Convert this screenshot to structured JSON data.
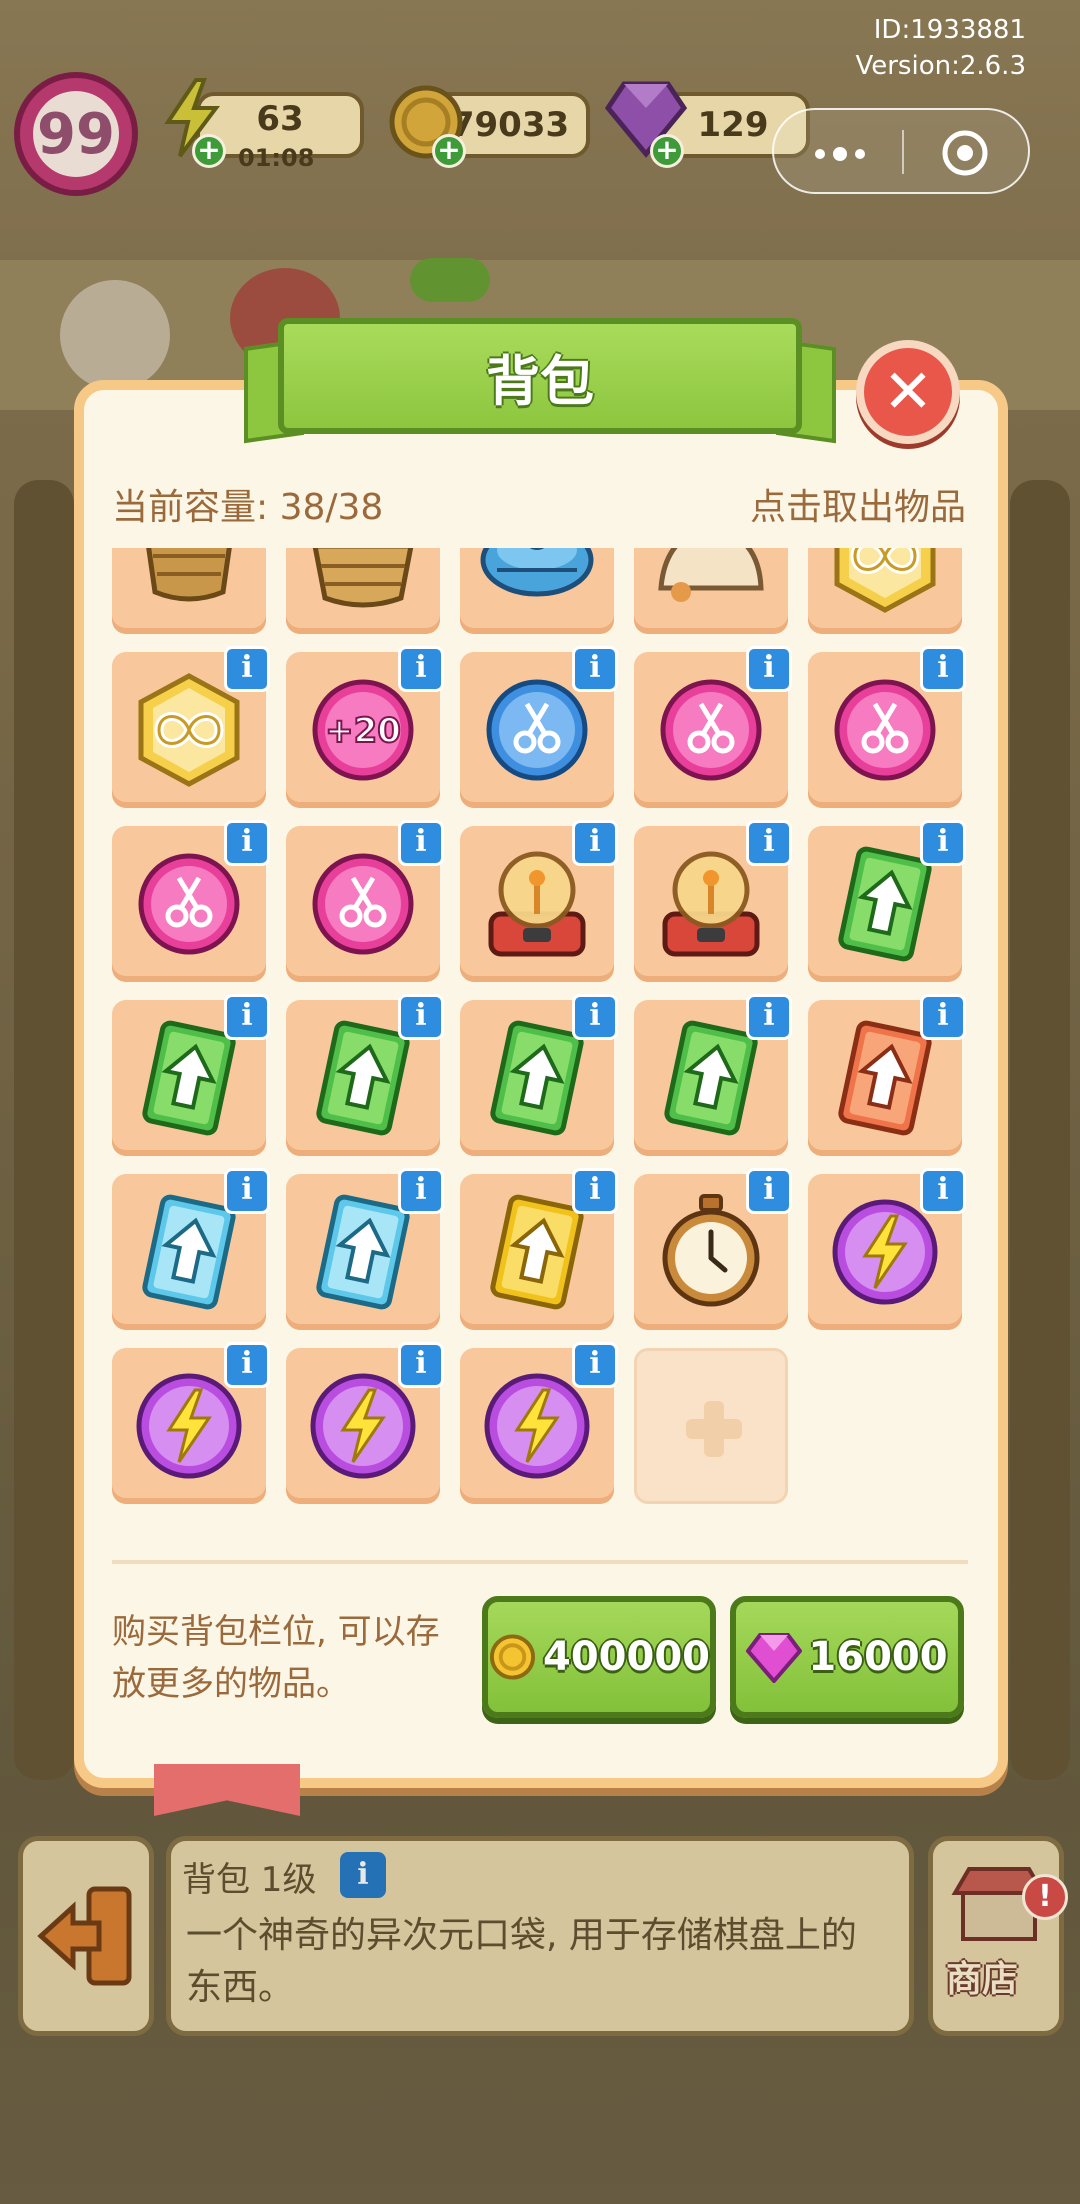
{
  "hud": {
    "level": "99",
    "energy": "63",
    "energy_timer": "01:08",
    "coins": "79033",
    "gems": "129",
    "id_text": "ID:1933881",
    "version_text": "Version:2.6.3"
  },
  "miniprogram_capsule": {
    "more_icon": "more-dots-icon",
    "close_icon": "target-circle-icon"
  },
  "modal": {
    "title": "背包",
    "capacity_label": "当前容量: 38/38",
    "take_out_hint": "点击取出物品",
    "slots": [
      {
        "item": "wicker-basket-small",
        "info": false
      },
      {
        "item": "wicker-basket",
        "info": false
      },
      {
        "item": "robot-vacuum",
        "info": false
      },
      {
        "item": "cream-bun",
        "info": false
      },
      {
        "item": "infinity-hexagon",
        "info": false
      },
      {
        "item": "infinity-hexagon",
        "info": true
      },
      {
        "item": "plus20-bubble",
        "info": true,
        "label": "+20"
      },
      {
        "item": "scissors-bubble-blue",
        "info": true
      },
      {
        "item": "scissors-bubble-pink",
        "info": true
      },
      {
        "item": "scissors-bubble-pink",
        "info": true
      },
      {
        "item": "scissors-bubble-pink",
        "info": true
      },
      {
        "item": "scissors-bubble-pink",
        "info": true
      },
      {
        "item": "plasma-machine",
        "info": true
      },
      {
        "item": "plasma-machine",
        "info": true
      },
      {
        "item": "upgrade-card-green",
        "info": true
      },
      {
        "item": "upgrade-card-green",
        "info": true
      },
      {
        "item": "upgrade-card-green",
        "info": true
      },
      {
        "item": "upgrade-card-green",
        "info": true
      },
      {
        "item": "upgrade-card-green",
        "info": true
      },
      {
        "item": "upgrade-card-orange",
        "info": true
      },
      {
        "item": "upgrade-card-blue",
        "info": true
      },
      {
        "item": "upgrade-card-blue",
        "info": true
      },
      {
        "item": "upgrade-card-yellow",
        "info": true
      },
      {
        "item": "stopwatch",
        "info": true
      },
      {
        "item": "energy-orb",
        "info": true
      },
      {
        "item": "energy-orb",
        "info": true
      },
      {
        "item": "energy-orb",
        "info": true
      },
      {
        "item": "energy-orb",
        "info": true
      },
      {
        "item": "empty-slot-plus",
        "info": false
      }
    ],
    "info_badge_text": "i",
    "buy_desc": "购买背包栏位, 可以存放更多的物品。",
    "buy_gold_price": "400000",
    "buy_gem_price": "16000"
  },
  "bottom_bar": {
    "item_title": "背包 1级",
    "item_title_info": "i",
    "item_desc": "一个神奇的异次元口袋, 用于存储棋盘上的东西。",
    "shop_label": "商店",
    "shop_alert": "!"
  },
  "colors": {
    "accent_green": "#8dc63f",
    "close_red": "#e8574a",
    "info_blue": "#2f8de0",
    "slot_peach": "#f8c89c",
    "panel_cream": "#fcf6e6"
  }
}
